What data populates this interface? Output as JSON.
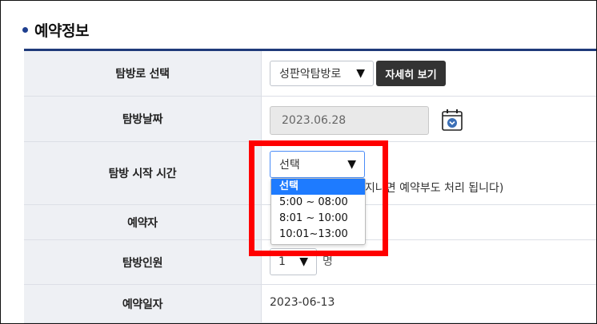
{
  "section": {
    "title": "예약정보"
  },
  "rows": {
    "route": {
      "label": "탐방로 선택",
      "selected": "성판악탐방로",
      "detail_button": "자세히 보기"
    },
    "date": {
      "label": "탐방날짜",
      "value": "2023.06.28"
    },
    "start_time": {
      "label": "탐방 시작 시간",
      "selected": "선택",
      "note_partial": "지나면 예약부도 처리 됩니다)",
      "options": [
        "선택",
        "5:00 ~ 08:00",
        "8:01 ~ 10:00",
        "10:01~13:00"
      ]
    },
    "reserver": {
      "label": "예약자"
    },
    "people": {
      "label": "탐방인원",
      "value": "1",
      "unit": "명"
    },
    "reserve_date": {
      "label": "예약일자",
      "value": "2023-06-13"
    }
  },
  "icons": {
    "arrow": "▼",
    "calendar": "calendar-icon"
  },
  "colors": {
    "accent": "#1f3a7a",
    "highlight": "#ff0000",
    "option_selected": "#1e7bff"
  }
}
